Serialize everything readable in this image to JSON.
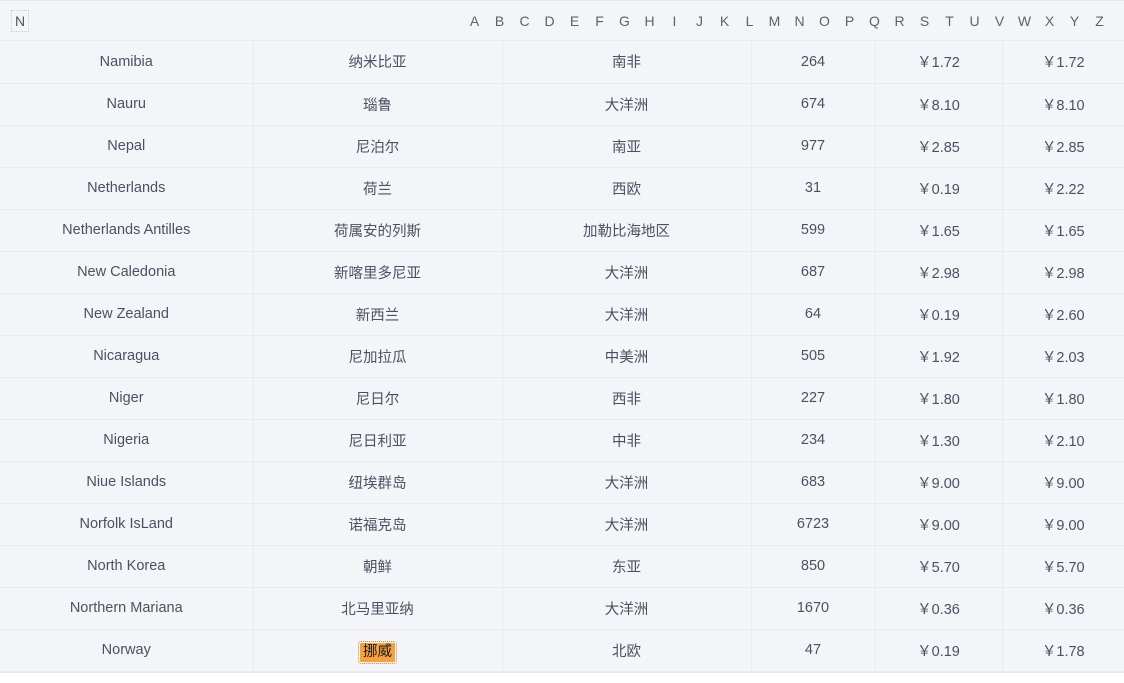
{
  "index": {
    "current_letter": "N",
    "letters": [
      "A",
      "B",
      "C",
      "D",
      "E",
      "F",
      "G",
      "H",
      "I",
      "J",
      "K",
      "L",
      "M",
      "N",
      "O",
      "P",
      "Q",
      "R",
      "S",
      "T",
      "U",
      "V",
      "W",
      "X",
      "Y",
      "Z"
    ]
  },
  "highlight": {
    "text": "挪威",
    "color": "#f5a23c"
  },
  "table": {
    "rows": [
      {
        "en": "Namibia",
        "zh": "纳米比亚",
        "region": "南非",
        "code": "264",
        "price1": "￥1.72",
        "price2": "￥1.72"
      },
      {
        "en": "Nauru",
        "zh": "瑙鲁",
        "region": "大洋洲",
        "code": "674",
        "price1": "￥8.10",
        "price2": "￥8.10"
      },
      {
        "en": "Nepal",
        "zh": "尼泊尔",
        "region": "南亚",
        "code": "977",
        "price1": "￥2.85",
        "price2": "￥2.85"
      },
      {
        "en": "Netherlands",
        "zh": "荷兰",
        "region": "西欧",
        "code": "31",
        "price1": "￥0.19",
        "price2": "￥2.22"
      },
      {
        "en": "Netherlands Antilles",
        "zh": "荷属安的列斯",
        "region": "加勒比海地区",
        "code": "599",
        "price1": "￥1.65",
        "price2": "￥1.65"
      },
      {
        "en": "New Caledonia",
        "zh": "新喀里多尼亚",
        "region": "大洋洲",
        "code": "687",
        "price1": "￥2.98",
        "price2": "￥2.98"
      },
      {
        "en": "New Zealand",
        "zh": "新西兰",
        "region": "大洋洲",
        "code": "64",
        "price1": "￥0.19",
        "price2": "￥2.60"
      },
      {
        "en": "Nicaragua",
        "zh": "尼加拉瓜",
        "region": "中美洲",
        "code": "505",
        "price1": "￥1.92",
        "price2": "￥2.03"
      },
      {
        "en": "Niger",
        "zh": "尼日尔",
        "region": "西非",
        "code": "227",
        "price1": "￥1.80",
        "price2": "￥1.80"
      },
      {
        "en": "Nigeria",
        "zh": "尼日利亚",
        "region": "中非",
        "code": "234",
        "price1": "￥1.30",
        "price2": "￥2.10"
      },
      {
        "en": "Niue Islands",
        "zh": "纽埃群岛",
        "region": "大洋洲",
        "code": "683",
        "price1": "￥9.00",
        "price2": "￥9.00"
      },
      {
        "en": "Norfolk IsLand",
        "zh": "诺福克岛",
        "region": "大洋洲",
        "code": "6723",
        "price1": "￥9.00",
        "price2": "￥9.00"
      },
      {
        "en": "North Korea",
        "zh": "朝鲜",
        "region": "东亚",
        "code": "850",
        "price1": "￥5.70",
        "price2": "￥5.70"
      },
      {
        "en": "Northern Mariana",
        "zh": "北马里亚纳",
        "region": "大洋洲",
        "code": "1670",
        "price1": "￥0.36",
        "price2": "￥0.36"
      },
      {
        "en": "Norway",
        "zh": "挪威",
        "region": "北欧",
        "code": "47",
        "price1": "￥0.19",
        "price2": "￥1.78"
      }
    ],
    "highlighted_row_index": 14,
    "highlighted_column": "zh"
  }
}
